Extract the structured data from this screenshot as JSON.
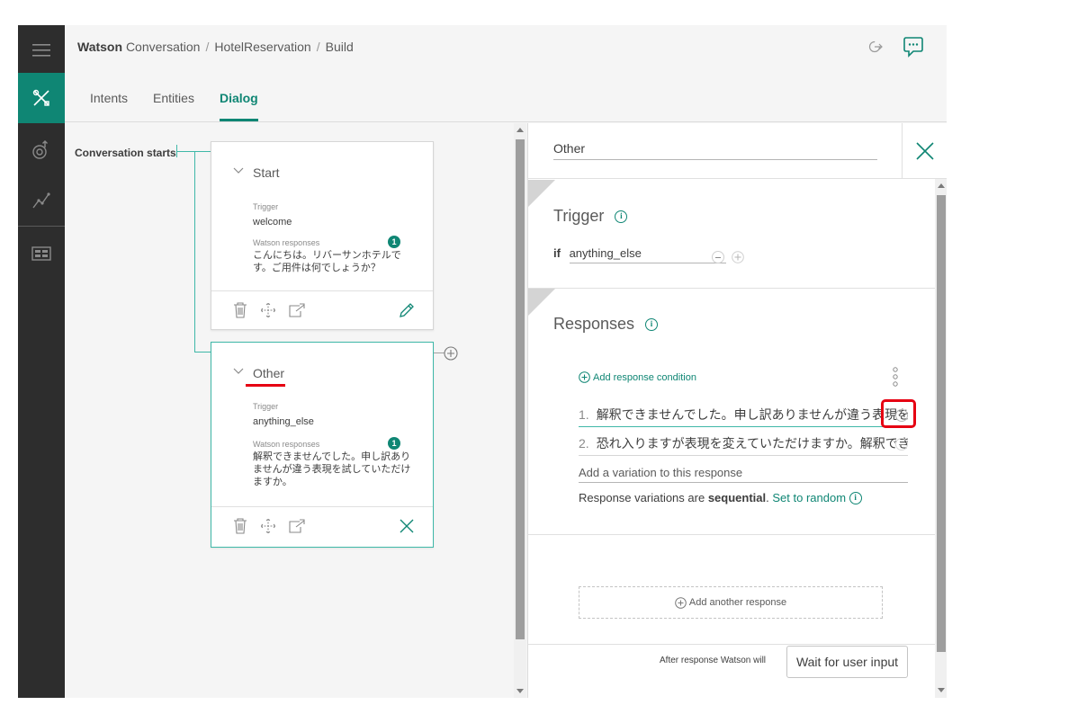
{
  "breadcrumb": {
    "brand": "Watson",
    "product": "Conversation",
    "workspace": "HotelReservation",
    "page": "Build"
  },
  "tabs": [
    {
      "label": "Intents",
      "active": false
    },
    {
      "label": "Entities",
      "active": false
    },
    {
      "label": "Dialog",
      "active": true
    }
  ],
  "canvas": {
    "conversation_label": "Conversation starts",
    "nodes": [
      {
        "title": "Start",
        "trigger_label": "Trigger",
        "trigger": "welcome",
        "responses_label": "Watson responses",
        "response_count": "1",
        "response": "こんにちは。リバーサンホテルです。ご用件は何でしょうか？"
      },
      {
        "title": "Other",
        "trigger_label": "Trigger",
        "trigger": "anything_else",
        "responses_label": "Watson responses",
        "response_count": "1",
        "response": "解釈できませんでした。申し訳ありませんが違う表現を試していただけますか。"
      }
    ]
  },
  "panel": {
    "node_name": "Other",
    "trigger": {
      "title": "Trigger",
      "if_label": "if",
      "condition": "anything_else"
    },
    "responses": {
      "title": "Responses",
      "add_condition": "Add response condition",
      "variations": [
        {
          "num": "1.",
          "text": "解釈できませんでした。申し訳ありませんが違う表現を試していただけますか。"
        },
        {
          "num": "2.",
          "text": "恐れ入りますが表現を変えていただけますか。解釈できませんでした。"
        }
      ],
      "add_variation_placeholder": "Add a variation to this response",
      "sequence_prefix": "Response variations are",
      "sequence_mode": "sequential",
      "sequence_period": ".",
      "set_random": "Set to random"
    },
    "add_another": "Add another response",
    "after_label": "After response Watson will",
    "after_action": "Wait for user input"
  },
  "colors": {
    "accent": "#0f8674",
    "rail": "#2d2d2d",
    "highlight": "#e60012",
    "tree_line": "#3fb8a8"
  }
}
